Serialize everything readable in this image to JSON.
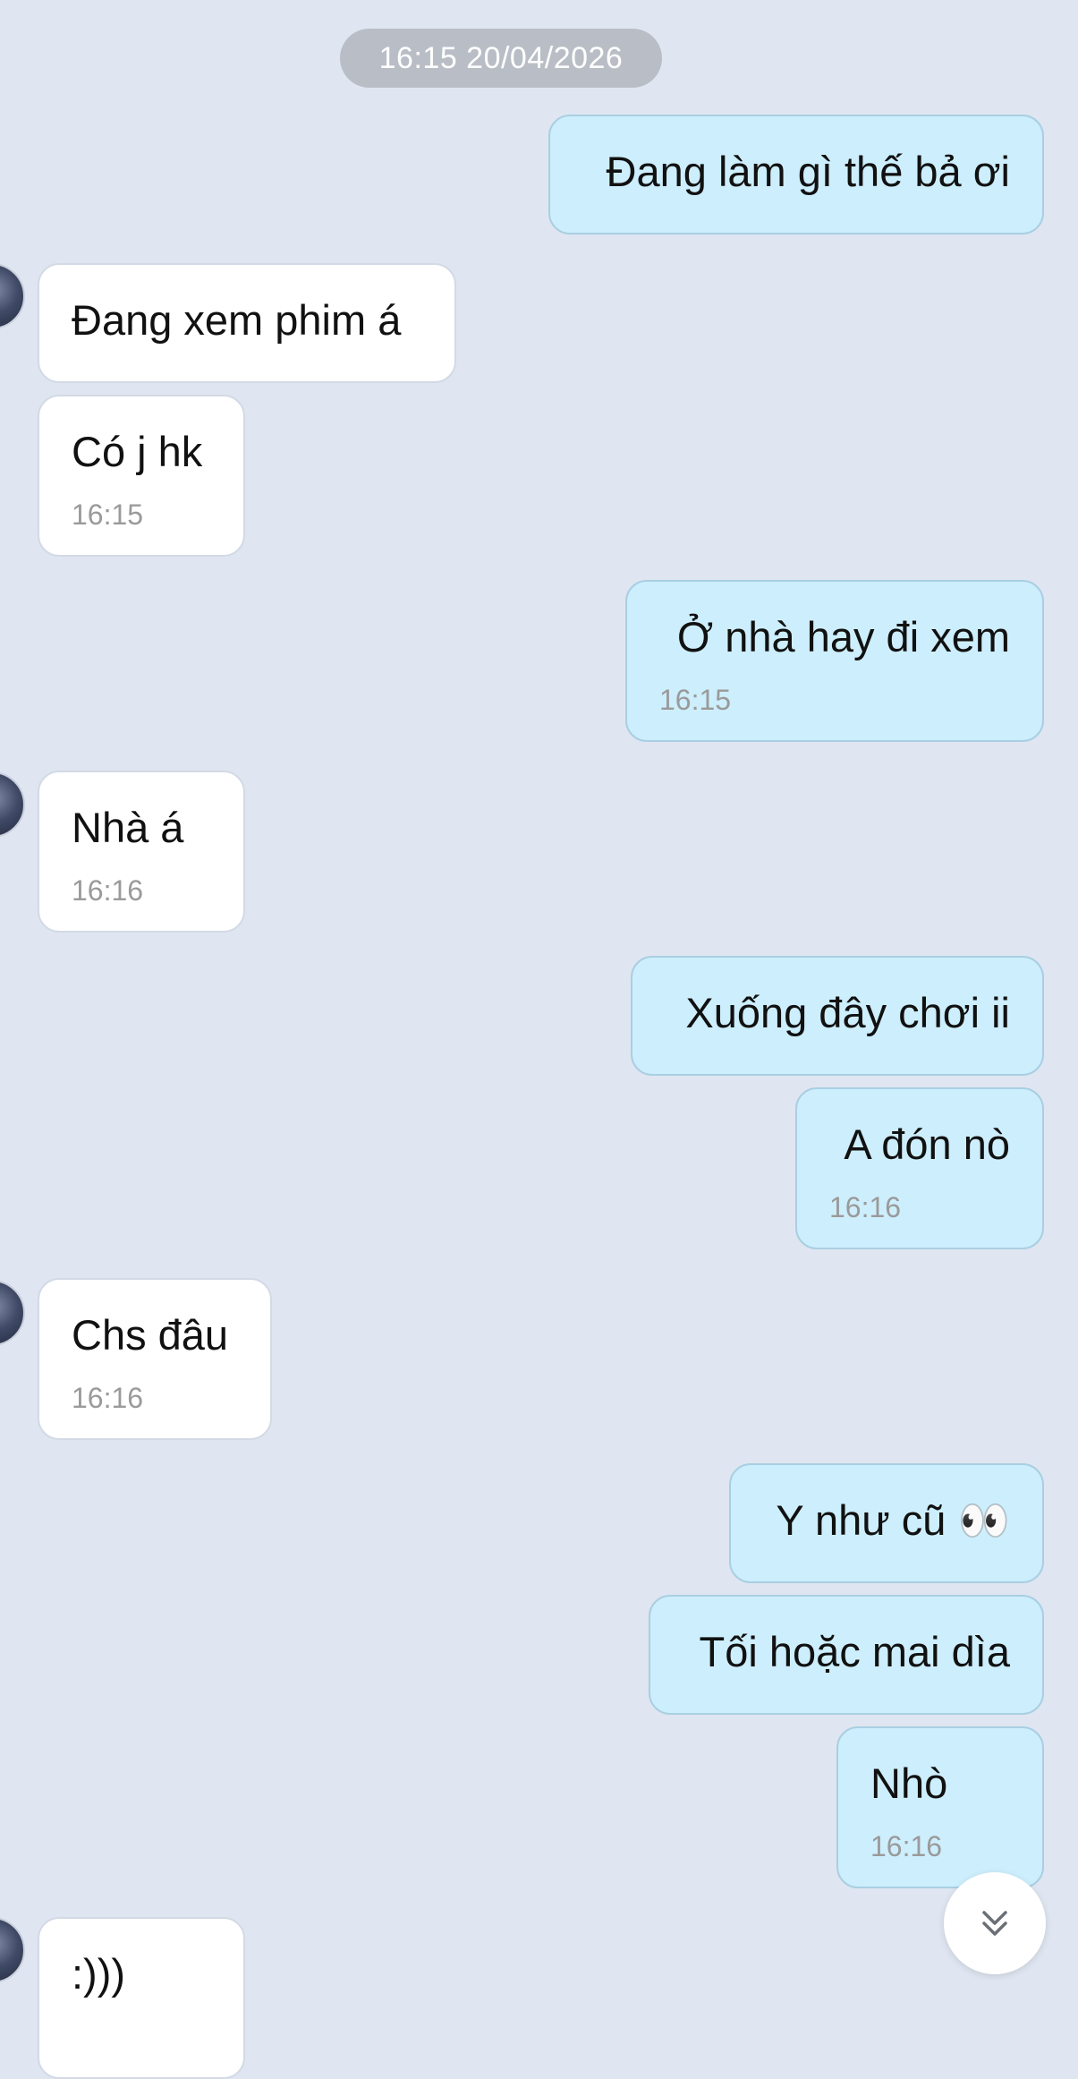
{
  "date_separator": "16:15 20/04/2026",
  "messages": [
    {
      "dir": "out",
      "text": "Đang làm gì thế bả ơi",
      "time": ""
    },
    {
      "dir": "in",
      "text": "Đang xem phim á",
      "time": ""
    },
    {
      "dir": "in",
      "text": "Có j hk",
      "time": "16:15"
    },
    {
      "dir": "out",
      "text": "Ở nhà hay đi xem",
      "time": "16:15"
    },
    {
      "dir": "in",
      "text": "Nhà á",
      "time": "16:16"
    },
    {
      "dir": "out",
      "text": "Xuống đây chơi ii",
      "time": ""
    },
    {
      "dir": "out",
      "text": "A đón nò",
      "time": "16:16"
    },
    {
      "dir": "in",
      "text": "Chs đâu",
      "time": "16:16"
    },
    {
      "dir": "out",
      "text": "Y như cũ 👀",
      "time": ""
    },
    {
      "dir": "out",
      "text": "Tối hoặc mai dìa",
      "time": ""
    },
    {
      "dir": "out",
      "text": "Nhò",
      "time": "16:16"
    },
    {
      "dir": "in",
      "text": ":)))",
      "time": ""
    }
  ],
  "scroll_button_icon": "chevron-double-down-icon",
  "colors": {
    "background": "#dfe6f1",
    "outgoing_bubble": "#cdeefc",
    "incoming_bubble": "#ffffff",
    "date_pill": "#b9bec6"
  }
}
